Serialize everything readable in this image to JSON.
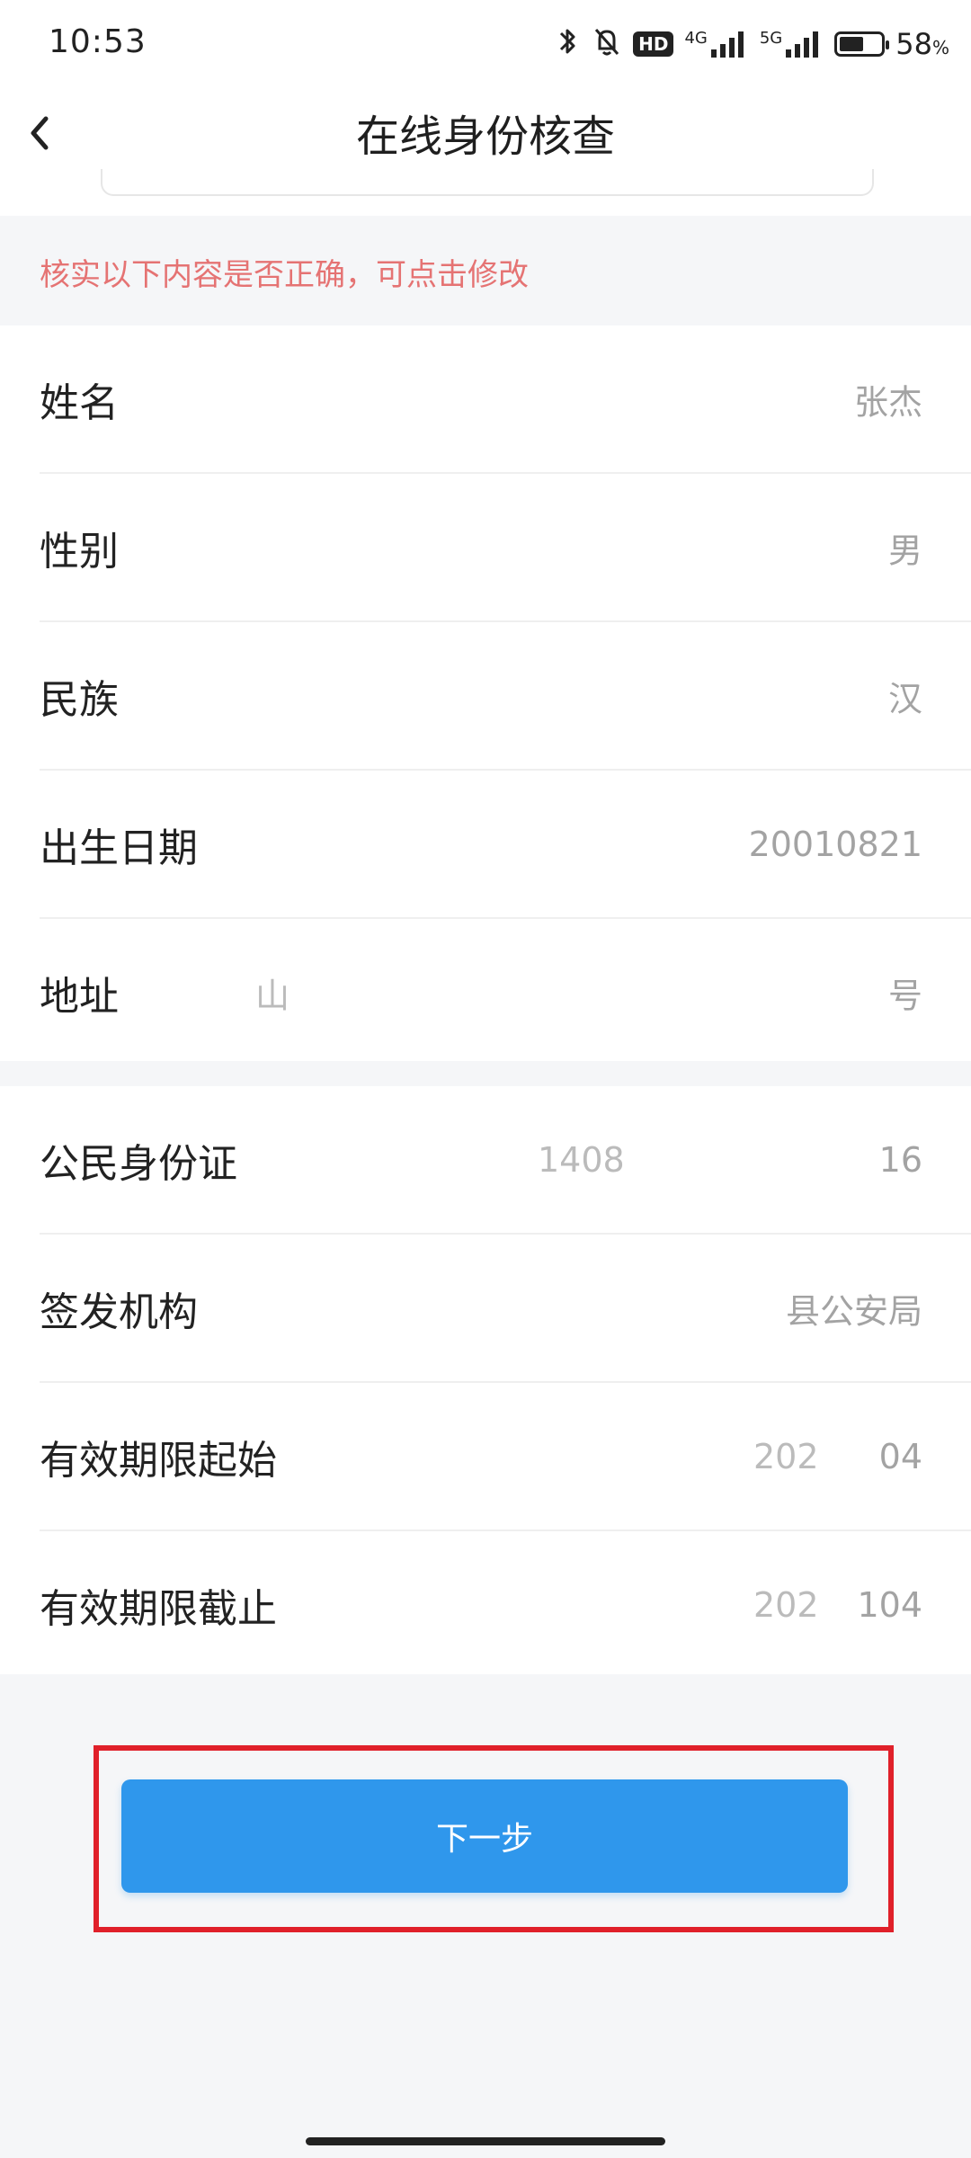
{
  "status_bar": {
    "time": "10:53",
    "hd_badge": "HD",
    "network_4g": "4G",
    "network_5g": "5G",
    "battery_level": 0.58,
    "battery_percent": "58",
    "percent_sign": "%"
  },
  "header": {
    "title": "在线身份核查"
  },
  "notice": {
    "text": "核实以下内容是否正确，可点击修改"
  },
  "section_personal": {
    "rows": [
      {
        "label": "姓名",
        "value": "张杰"
      },
      {
        "label": "性别",
        "value": "男"
      },
      {
        "label": "民族",
        "value": "汉"
      },
      {
        "label": "出生日期",
        "value": "20010821"
      },
      {
        "label": "地址",
        "value_left": "山",
        "value": "号"
      }
    ]
  },
  "section_id": {
    "rows": [
      {
        "label": "公民身份证",
        "value_left": "1408",
        "value": "16"
      },
      {
        "label": "签发机构",
        "value": "县公安局"
      },
      {
        "label": "有效期限起始",
        "value_left": "202",
        "value": "04"
      },
      {
        "label": "有效期限截止",
        "value_left": "202",
        "value": "104"
      }
    ]
  },
  "actions": {
    "next_label": "下一步"
  },
  "colors": {
    "accent": "#2f97ec",
    "notice": "#e57373",
    "highlight": "#e0202a"
  }
}
